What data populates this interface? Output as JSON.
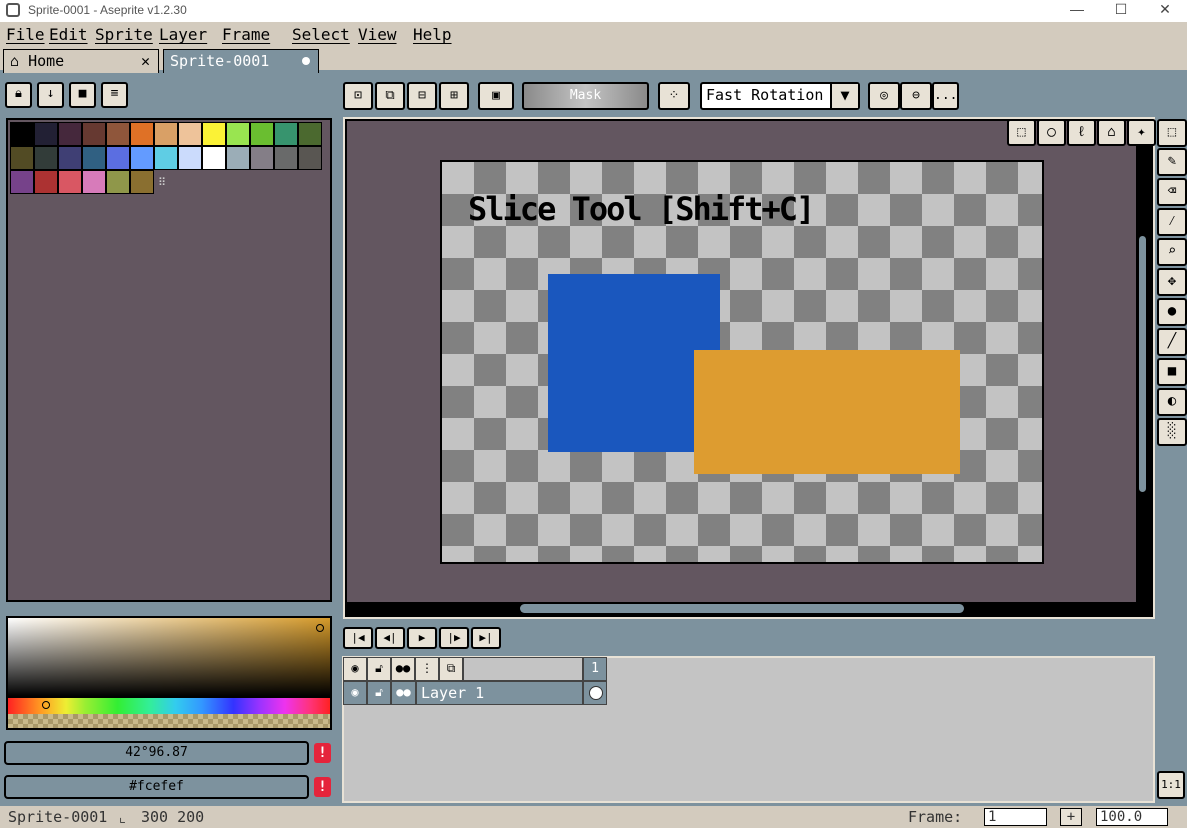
{
  "window": {
    "title": "Sprite-0001 - Aseprite v1.2.30",
    "minimize": "—",
    "maximize": "☐",
    "close": "✕"
  },
  "menu": [
    "File",
    "Edit",
    "Sprite",
    "Layer",
    "Frame",
    "Select",
    "View",
    "Help"
  ],
  "tabs": [
    {
      "label": "Home",
      "icon": "home-icon",
      "close": "✕"
    },
    {
      "label": "Sprite-0001",
      "icon": "modified-dot-icon",
      "active": true
    }
  ],
  "palette_toolbar": [
    "lock-icon",
    "down-arrow-icon",
    "save-icon",
    "menu-icon"
  ],
  "palette": {
    "rows": [
      [
        "#000000",
        "#222034",
        "#45283c",
        "#663931",
        "#8f563b",
        "#df7126",
        "#d9a066",
        "#eec39a",
        "#fbf236",
        "#99e550",
        "#6abe30",
        "#37946e",
        "#4b692f"
      ],
      [
        "#524b24",
        "#323c39",
        "#3f3f74",
        "#306082",
        "#5b6ee1",
        "#639bff",
        "#5fcde4",
        "#cbdbfc",
        "#ffffff",
        "#9badb7",
        "#847e87",
        "#696a6a",
        "#595652"
      ],
      [
        "#76428a",
        "#ac3232",
        "#d95763",
        "#d77bba",
        "#8f974a",
        "#8a6f30"
      ]
    ],
    "resize_handle": "⠿"
  },
  "colors": {
    "foreground": {
      "label": "42°96.87",
      "swatch": "#dd9c30"
    },
    "background": {
      "label": "#fcefef",
      "swatch": "#fcefef"
    },
    "warn_icon": "!"
  },
  "editor_toolbar": {
    "selection_modes": [
      "replace-selection-icon",
      "add-selection-icon",
      "subtract-selection-icon",
      "intersect-selection-icon"
    ],
    "transparent_icon": "transparent-color-icon",
    "mask_label": "Mask",
    "pivot_icon": "pivot-icon",
    "rotation_algorithm": "Fast Rotation",
    "extra_icons": [
      "rotate-icon",
      "scale-icon"
    ],
    "more": "..."
  },
  "canvas": {
    "label": "Slice Tool [Shift+C]",
    "shapes": [
      {
        "name": "blue rectangle",
        "color": "#1a57be"
      },
      {
        "name": "orange rectangle",
        "color": "#dd9c30"
      }
    ]
  },
  "tools": {
    "top_row": [
      "rect-marquee-icon",
      "ellipse-marquee-icon",
      "lasso-icon",
      "polygonal-lasso-icon",
      "magic-wand-icon"
    ],
    "column": [
      "rect-marquee-icon",
      "pencil-icon",
      "eraser-icon",
      "eyedropper-icon",
      "zoom-icon",
      "move-icon",
      "paint-bucket-icon",
      "line-icon",
      "rectangle-icon",
      "contour-icon",
      "blur-icon"
    ]
  },
  "timeline": {
    "playback": [
      "first-frame-icon",
      "prev-frame-icon",
      "play-icon",
      "next-frame-icon",
      "last-frame-icon"
    ],
    "header_icons": [
      "eye-icon",
      "padlock-icon",
      "continuous-icon",
      "tree-icon",
      "onion-skin-icon"
    ],
    "frame_number": "1",
    "layers": [
      {
        "name": "Layer 1",
        "icons": [
          "eye-icon",
          "padlock-icon",
          "continuous-icon"
        ]
      }
    ],
    "one_to_one": "1:1"
  },
  "status": {
    "sprite_name": "Sprite-0001",
    "size_icon": "sprite-size-icon",
    "size": "300 200",
    "frame_label": "Frame:",
    "frame_value": "1",
    "add_button": "+",
    "zoom": "100.0"
  }
}
